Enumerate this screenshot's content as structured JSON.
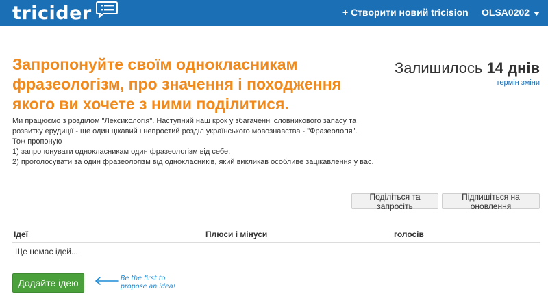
{
  "header": {
    "logo": "tricider",
    "create_link": "+ Створити новий tricision",
    "user": "OLSA0202"
  },
  "title": "Запропонуйте своїм однокласникам фразеологізм, про значення і походження якого ви хочете з ними поділитися.",
  "countdown": {
    "prefix": "Залишилось",
    "value": "14 днів",
    "change_link": "термін зміни"
  },
  "description": [
    "Ми працюємо з розділом \"Лексикологія\". Наступний наш крок у збагаченні словникового запасу та розвитку ерудиції - ще один цікавий і непростий розділ українського мовознавства - \"Фразеологія\".",
    "Тож пропоную",
    "1) запропонувати однокласникам один фразеологізм від себе;",
    "2) проголосувати за один фразеологізм від однокласників, який викликав особливе зацікавлення у вас."
  ],
  "actions": {
    "share": "Поділіться та запросіть",
    "subscribe": "Підпишіться на оновлення"
  },
  "table": {
    "columns": [
      "Ідеї",
      "Плюси і мінуси",
      "голосів"
    ],
    "empty": "Ще немає ідей..."
  },
  "add_idea": {
    "label": "Додайте ідею",
    "hint_line1": "Be the first to",
    "hint_line2": "propose an idea!"
  },
  "colors": {
    "topbar": "#1b6fb5",
    "accent": "#f08a1c",
    "add_button": "#4aa03b",
    "link": "#1b6fb5"
  },
  "icons": {
    "logo": "speech-bubble-list-icon",
    "user_menu": "caret-down-icon",
    "hint": "arrow-left-icon"
  }
}
